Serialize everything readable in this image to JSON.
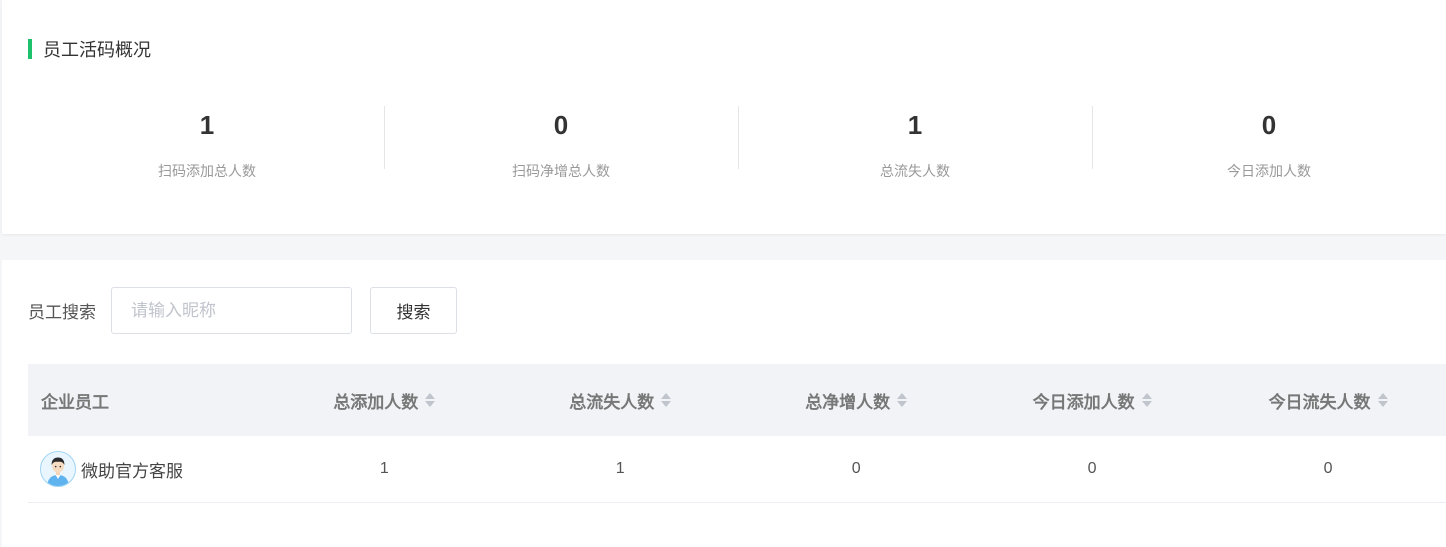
{
  "overview": {
    "title": "员工活码概况",
    "accent_color": "#1ec16c",
    "stats": [
      {
        "value": "1",
        "label": "扫码添加总人数"
      },
      {
        "value": "0",
        "label": "扫码净增总人数"
      },
      {
        "value": "1",
        "label": "总流失人数"
      },
      {
        "value": "0",
        "label": "今日添加人数"
      }
    ]
  },
  "search": {
    "label": "员工搜索",
    "placeholder": "请输入昵称",
    "value": "",
    "button_label": "搜索"
  },
  "table": {
    "columns": [
      {
        "label": "企业员工",
        "sortable": false
      },
      {
        "label": "总添加人数",
        "sortable": true
      },
      {
        "label": "总流失人数",
        "sortable": true
      },
      {
        "label": "总净增人数",
        "sortable": true
      },
      {
        "label": "今日添加人数",
        "sortable": true
      },
      {
        "label": "今日流失人数",
        "sortable": true
      }
    ],
    "rows": [
      {
        "avatar_icon": "user-avatar-icon",
        "name": "微助官方客服",
        "cells": [
          "1",
          "1",
          "0",
          "0",
          "0"
        ]
      }
    ]
  }
}
